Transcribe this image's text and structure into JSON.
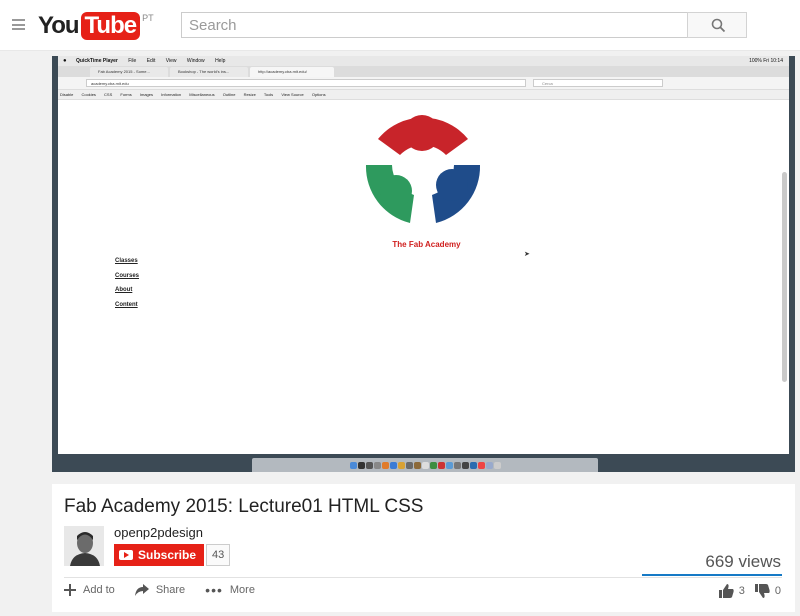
{
  "masthead": {
    "logo_you": "You",
    "logo_tube": "Tube",
    "logo_country": "PT",
    "search_placeholder": "Search"
  },
  "player": {
    "mac_menu": {
      "apple": "",
      "items": [
        "QuickTime Player",
        "File",
        "Edit",
        "View",
        "Window",
        "Help"
      ],
      "right_status": "100% Fri 10:14"
    },
    "browser": {
      "tabs": [
        "Fab Academy 2015 - Some...",
        "Bookshop - The world's ins...",
        "http://academy.cba.mit.edu/"
      ],
      "url": "academy.cba.mit.edu",
      "search_placeholder": "Cerca",
      "toolbar_items": [
        "Disable",
        "Cookies",
        "CSS",
        "Forms",
        "Images",
        "Information",
        "Miscellaneous",
        "Outline",
        "Resize",
        "Tools",
        "View Source",
        "Options"
      ]
    },
    "page": {
      "title": "The Fab Academy",
      "links": [
        "Classes",
        "Courses",
        "About",
        "Content"
      ]
    }
  },
  "video": {
    "title": "Fab Academy 2015: Lecture01 HTML CSS",
    "channel": "openp2pdesign",
    "subscribe_label": "Subscribe",
    "subscriber_count": "43",
    "views": "669 views",
    "actions": {
      "add_to": "Add to",
      "share": "Share",
      "more": "More"
    },
    "likes": "3",
    "dislikes": "0"
  },
  "colors": {
    "brand_red": "#e62117",
    "fab_red": "#c8242a",
    "fab_green": "#2e9a5e",
    "fab_blue": "#1f4c8a",
    "view_bar": "#167ac6"
  }
}
